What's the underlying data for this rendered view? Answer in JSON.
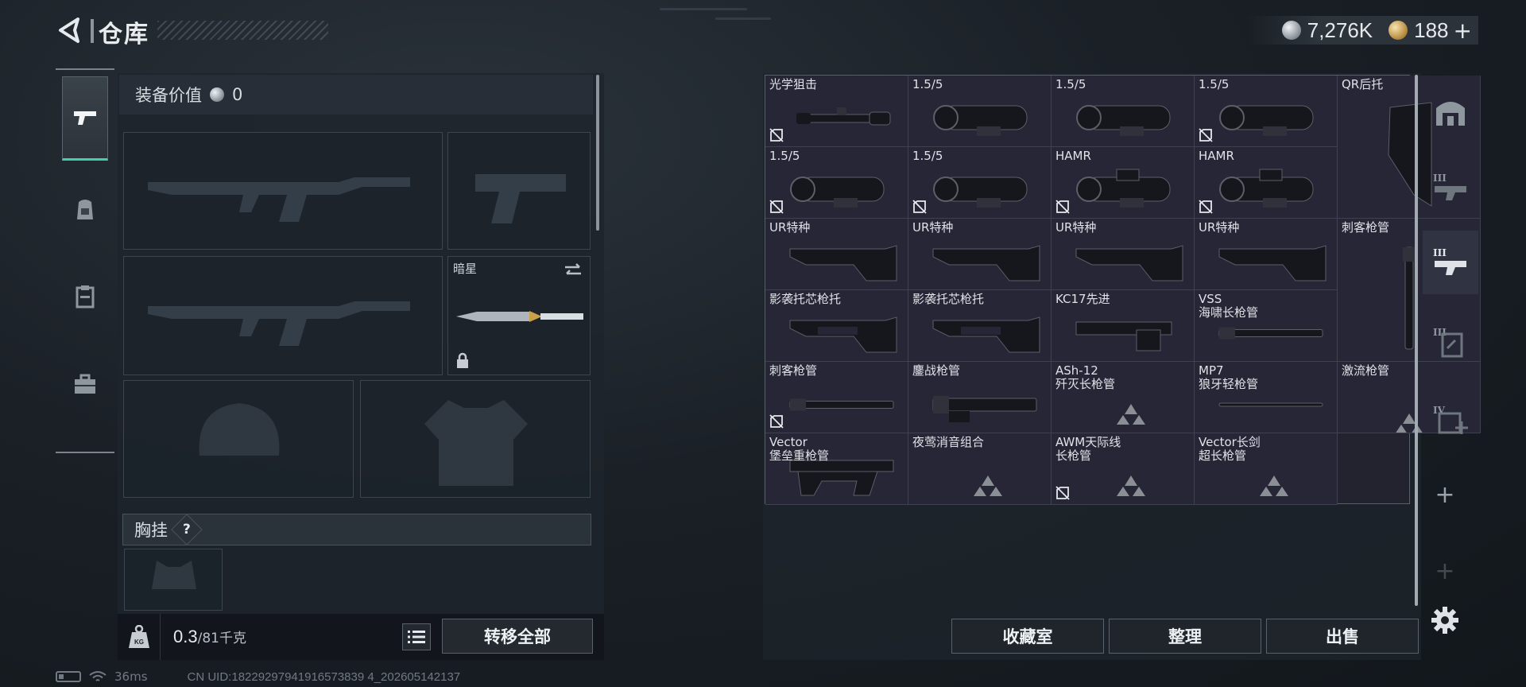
{
  "header": {
    "title": "仓库",
    "currency_silver": "7,276K",
    "currency_gold": "188",
    "gold_plus": "+"
  },
  "left_tabs": [
    {
      "icon": "pistol-icon",
      "active": true
    },
    {
      "icon": "backpack-icon",
      "active": false
    },
    {
      "icon": "clipboard-icon",
      "active": false
    },
    {
      "icon": "toolbox-icon",
      "active": false
    }
  ],
  "equipment": {
    "value_label": "装备价值",
    "value": "0",
    "melee_name": "暗星",
    "vest_label": "胸挂",
    "help": "?",
    "weight_current": "0.3",
    "weight_max": "/81千克",
    "transfer_all": "转移全部"
  },
  "storage_items": [
    {
      "name": "光学狙击",
      "icon": "scope",
      "nodrop": true
    },
    {
      "name": "1.5/5",
      "icon": "optic",
      "nodrop": false
    },
    {
      "name": "1.5/5",
      "icon": "optic",
      "nodrop": false
    },
    {
      "name": "1.5/5",
      "icon": "optic",
      "nodrop": true
    },
    {
      "name": "QR后托",
      "icon": "stock-tall",
      "nodrop": false
    },
    {
      "name": "1.5/5",
      "icon": "optic",
      "nodrop": true
    },
    {
      "name": "1.5/5",
      "icon": "optic",
      "nodrop": true
    },
    {
      "name": "HAMR",
      "icon": "optic-hamr",
      "nodrop": true
    },
    {
      "name": "HAMR",
      "icon": "optic-hamr",
      "nodrop": true
    },
    {
      "name": "UR特种",
      "icon": "stock",
      "nodrop": false
    },
    {
      "name": "UR特种",
      "icon": "stock",
      "nodrop": false
    },
    {
      "name": "UR特种",
      "icon": "stock",
      "nodrop": false
    },
    {
      "name": "UR特种",
      "icon": "stock",
      "nodrop": false
    },
    {
      "name": "刺客枪管",
      "icon": "barrel-vertical",
      "nodrop": false
    },
    {
      "name": "影袭托芯枪托",
      "icon": "stock-skeletal",
      "nodrop": false
    },
    {
      "name": "影袭托芯枪托",
      "icon": "stock-skeletal",
      "nodrop": false
    },
    {
      "name": "KC17先进",
      "icon": "stock-folding",
      "nodrop": false
    },
    {
      "name": "VSS\n海啸长枪管",
      "icon": "barrel-long",
      "nodrop": false
    },
    {
      "name": "刺客枪管",
      "icon": "barrel",
      "nodrop": true
    },
    {
      "name": "鏖战枪管",
      "icon": "barrel-rail",
      "nodrop": false
    },
    {
      "name": "ASh-12\n歼灭长枪管",
      "icon": "triangles",
      "nodrop": false
    },
    {
      "name": "MP7\n狼牙轻枪管",
      "icon": "barrel-thin",
      "nodrop": false
    },
    {
      "name": "激流枪管",
      "icon": "triangles",
      "nodrop": false
    },
    {
      "name": "Vector\n堡垒重枪管",
      "icon": "vector",
      "nodrop": false
    },
    {
      "name": "夜莺消音组合",
      "icon": "triangles",
      "nodrop": false
    },
    {
      "name": "AWM天际线\n长枪管",
      "icon": "triangles",
      "nodrop": true
    },
    {
      "name": "Vector长剑\n超长枪管",
      "icon": "triangles",
      "nodrop": false
    }
  ],
  "bottom_buttons": {
    "collection": "收藏室",
    "organize": "整理",
    "sell": "出售"
  },
  "status": {
    "ping": "36ms",
    "uid": "CN UID:18229297941916573839 4_202605142137"
  }
}
